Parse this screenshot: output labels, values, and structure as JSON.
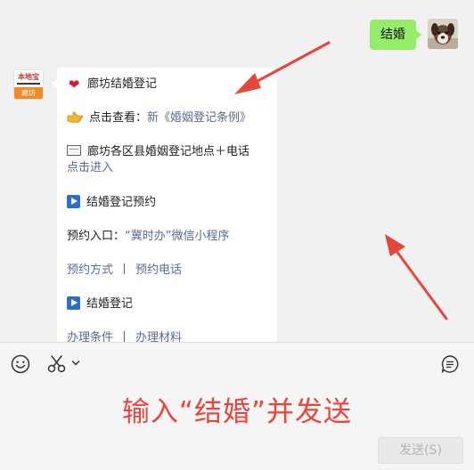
{
  "chat": {
    "sent_message": "结婚",
    "bot_avatar": {
      "logo_text": "本地宝",
      "city_label": "廊坊"
    },
    "reply": {
      "title": "廊坊结婚登记",
      "view_prefix": "点击查看：",
      "view_link": "新《婚姻登记条例》",
      "locations_label": "廊坊各区县婚姻登记地点＋电话",
      "locations_link": "点击进入",
      "appointment_title": "结婚登记预约",
      "entry_prefix": "预约入口：",
      "entry_link": "“冀时办”微信小程序",
      "method_link": "预约方式",
      "separator": "丨",
      "phone_link": "预约电话",
      "registration_title": "结婚登记",
      "conditions_link": "办理条件",
      "materials_link": "办理材料"
    }
  },
  "input_panel": {
    "input_value": "输入“结婚”并发送",
    "send_label": "发送(S)"
  },
  "icons": {
    "emoji": "smiley-icon",
    "screenshot": "scissors-icon",
    "dropdown": "chevron-down-icon",
    "history": "chat-history-icon",
    "heart": "heart-icon",
    "pointer": "pointing-hand-icon",
    "envelope": "envelope-icon",
    "play": "play-icon"
  },
  "colors": {
    "sent_bubble": "#95ec69",
    "link": "#576b95",
    "annotation_red": "#e8453c",
    "heart_red": "#d81e2c",
    "play_blue": "#2a6fcf"
  }
}
